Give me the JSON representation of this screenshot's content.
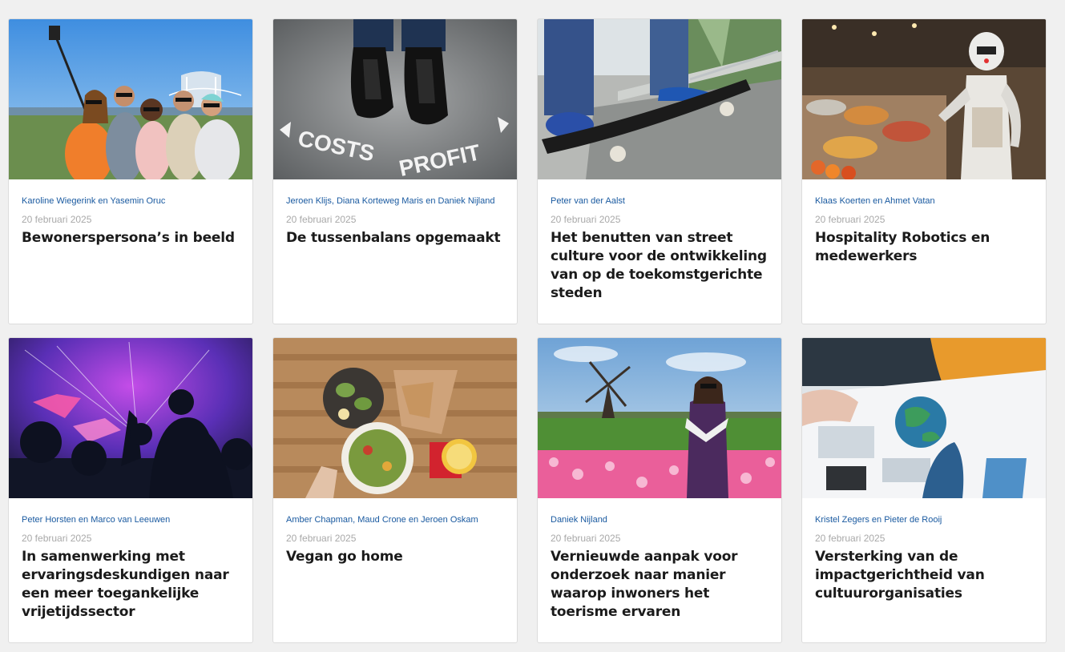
{
  "cards": [
    {
      "authors": "Karoline Wiegerink en Yasemin Oruc",
      "date": "20 februari 2025",
      "title": "Bewonerspersona’s in beeld",
      "image": "group-selfie-photo"
    },
    {
      "authors": "Jeroen Klijs, Diana Korteweg Maris en Daniek Nijland",
      "date": "20 februari 2025",
      "title": "De tussenbalans opgemaakt",
      "image": "costs-profit-shoes-photo",
      "image_text": {
        "left": "COSTS",
        "right": "PROFIT"
      }
    },
    {
      "authors": "Peter van der Aalst",
      "date": "20 februari 2025",
      "title": "Het benutten van street culture voor de ontwikkeling van op de toekomstgerichte steden",
      "image": "skateboard-photo"
    },
    {
      "authors": "Klaas Koerten en Ahmet Vatan",
      "date": "20 februari 2025",
      "title": "Hospitality Robotics en medewerkers",
      "image": "robot-buffet-photo"
    },
    {
      "authors": "Peter Horsten en Marco van Leeuwen",
      "date": "20 februari 2025",
      "title": "In samenwerking met ervaringsdeskundigen naar een meer toegankelijke vrijetijdssector",
      "image": "concert-crowd-photo"
    },
    {
      "authors": "Amber Chapman, Maud Crone en Jeroen Oskam",
      "date": "20 februari 2025",
      "title": "Vegan go home",
      "image": "vegan-food-photo"
    },
    {
      "authors": "Daniek Nijland",
      "date": "20 februari 2025",
      "title": "Vernieuwde aanpak voor onderzoek naar manier waarop inwoners het toerisme ervaren",
      "image": "windmill-tulips-photo"
    },
    {
      "authors": "Kristel Zegers en Pieter de Rooij",
      "date": "20 februari 2025",
      "title": "Versterking van de impactgerichtheid van cultuurorganisaties",
      "image": "globe-meeting-photo"
    }
  ]
}
